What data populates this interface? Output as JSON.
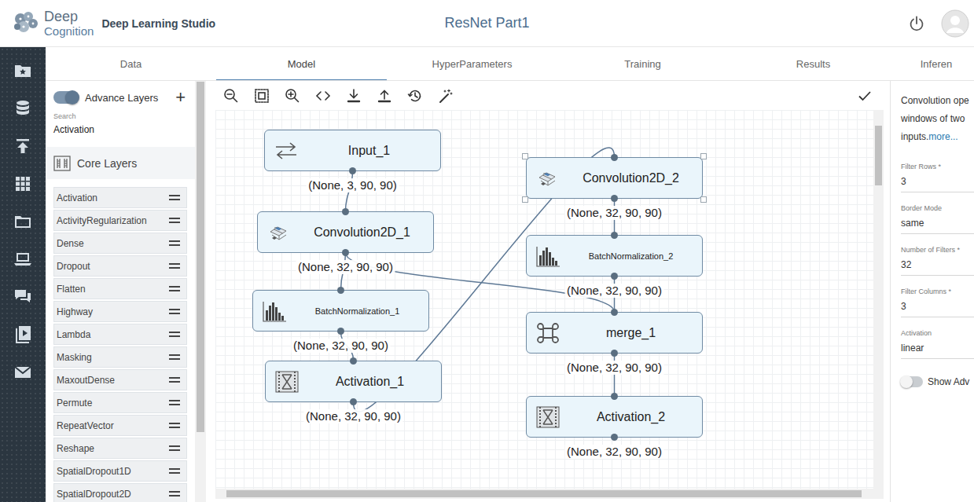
{
  "header": {
    "logo_top": "Deep",
    "logo_bottom": "Cognition",
    "app_name": "Deep Learning Studio",
    "title": "ResNet Part1"
  },
  "tabs": [
    {
      "label": "Data",
      "selected": false
    },
    {
      "label": "Model",
      "selected": true
    },
    {
      "label": "HyperParameters",
      "selected": false
    },
    {
      "label": "Training",
      "selected": false
    },
    {
      "label": "Results",
      "selected": false
    },
    {
      "label": "Inferen",
      "selected": false
    }
  ],
  "layer_panel": {
    "advance_toggle": {
      "label": "Advance Layers",
      "on": true
    },
    "add_button": "+",
    "search": {
      "label": "Search",
      "value": "Activation"
    },
    "group": {
      "label": "Core Layers",
      "expanded": true
    },
    "items": [
      "Activation",
      "ActivityRegularization",
      "Dense",
      "Dropout",
      "Flatten",
      "Highway",
      "Lambda",
      "Masking",
      "MaxoutDense",
      "Permute",
      "RepeatVector",
      "Reshape",
      "SpatialDropout1D",
      "SpatialDropout2D"
    ]
  },
  "canvas": {
    "nodes": [
      {
        "name": "Input_1",
        "kind": "input",
        "shape": "(None, 3, 90, 90)",
        "selected": false
      },
      {
        "name": "Convolution2D_1",
        "kind": "conv",
        "shape": "(None, 32, 90, 90)",
        "selected": false
      },
      {
        "name": "BatchNormalization_1",
        "kind": "batchnorm",
        "shape": "(None, 32, 90, 90)",
        "selected": false
      },
      {
        "name": "Activation_1",
        "kind": "activation",
        "shape": "(None, 32, 90, 90)",
        "selected": false
      },
      {
        "name": "Convolution2D_2",
        "kind": "conv",
        "shape": "(None, 32, 90, 90)",
        "selected": true
      },
      {
        "name": "BatchNormalization_2",
        "kind": "batchnorm",
        "shape": "(None, 32, 90, 90)",
        "selected": false
      },
      {
        "name": "merge_1",
        "kind": "merge",
        "shape": "(None, 32, 90, 90)",
        "selected": false
      },
      {
        "name": "Activation_2",
        "kind": "activation",
        "shape": "(None, 32, 90, 90)",
        "selected": false
      }
    ],
    "edges": [
      {
        "from": "Input_1",
        "to": "Convolution2D_1"
      },
      {
        "from": "Convolution2D_1",
        "to": "BatchNormalization_1"
      },
      {
        "from": "Convolution2D_1",
        "to": "merge_1"
      },
      {
        "from": "BatchNormalization_1",
        "to": "Activation_1"
      },
      {
        "from": "Activation_1",
        "to": "Convolution2D_2"
      },
      {
        "from": "Convolution2D_2",
        "to": "BatchNormalization_2"
      },
      {
        "from": "BatchNormalization_2",
        "to": "merge_1"
      },
      {
        "from": "merge_1",
        "to": "Activation_2"
      }
    ]
  },
  "properties": {
    "description": [
      "Convolution ope",
      "windows of two",
      "inputs."
    ],
    "more_link": "more...",
    "fields": [
      {
        "label": "Filter Rows *",
        "value": "3"
      },
      {
        "label": "Border Mode",
        "value": "same"
      },
      {
        "label": "Number of Filters *",
        "value": "32"
      },
      {
        "label": "Filter Columns *",
        "value": "3"
      },
      {
        "label": "Activation",
        "value": "linear"
      }
    ],
    "show_advanced": {
      "label": "Show Adv",
      "on": false
    }
  }
}
